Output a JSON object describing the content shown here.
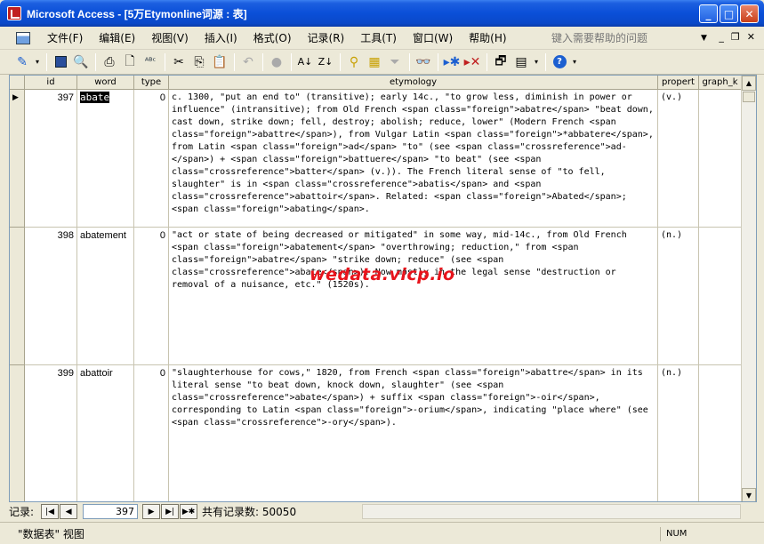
{
  "window": {
    "title": "Microsoft Access - [5万Etymonline词源 : 表]"
  },
  "menubar": {
    "items": [
      "文件(F)",
      "编辑(E)",
      "视图(V)",
      "插入(I)",
      "格式(O)",
      "记录(R)",
      "工具(T)",
      "窗口(W)",
      "帮助(H)"
    ],
    "help_placeholder": "键入需要帮助的问题"
  },
  "grid": {
    "columns": [
      "id",
      "word",
      "type",
      "etymology",
      "propert",
      "graph_k"
    ],
    "rows": [
      {
        "id": "397",
        "word": "abate",
        "type": "0",
        "etymology": "c. 1300, \"put an end to\"  (transitive); early 14c., \"to grow less, diminish in power or influence\" (intransitive); from Old French <span class=\"foreign\">abatre</span> \"beat down, cast down, strike down; fell, destroy; abolish; reduce, lower\" (Modern French <span class=\"foreign\">abattre</span>), from Vulgar Latin <span class=\"foreign\">*abbatere</span>, from Latin <span class=\"foreign\">ad</span> \"to\" (see <span class=\"crossreference\">ad-</span>) + <span class=\"foreign\">battuere</span> \"to beat\" (see <span class=\"crossreference\">batter</span> (v.)). The French literal sense of \"to fell, slaughter\" is in <span class=\"crossreference\">abatis</span> and <span class=\"crossreference\">abattoir</span>. Related: <span class=\"foreign\">Abated</span>; <span class=\"foreign\">abating</span>.",
        "property": "(v.)"
      },
      {
        "id": "398",
        "word": "abatement",
        "type": "0",
        "etymology": "\"act or state of being decreased or mitigated\" in some way, mid-14c., from Old French <span class=\"foreign\">abatement</span> \"overthrowing; reduction,\" from <span class=\"foreign\">abatre</span> \"strike down; reduce\" (see <span class=\"crossreference\">abate</span>). Now mostly in the legal sense \"destruction or removal of a nuisance, etc.\" (1520s).",
        "property": "(n.)"
      },
      {
        "id": "399",
        "word": "abattoir",
        "type": "0",
        "etymology": "\"slaughterhouse for cows,\" 1820, from French <span class=\"foreign\">abattre</span> in its literal sense \"to beat down, knock down, slaughter\" (see <span class=\"crossreference\">abate</span>) + suffix <span class=\"foreign\">-oir</span>, corresponding to Latin <span class=\"foreign\">-orium</span>, indicating \"place where\" (see <span class=\"crossreference\">-ory</span>).",
        "property": "(n.)"
      }
    ]
  },
  "watermark": "wedata.vicp.io",
  "recnav": {
    "label": "记录:",
    "current": "397",
    "total_text": "共有记录数: 50050"
  },
  "statusbar": {
    "view_text": "\"数据表\" 视图",
    "num": "NUM"
  }
}
